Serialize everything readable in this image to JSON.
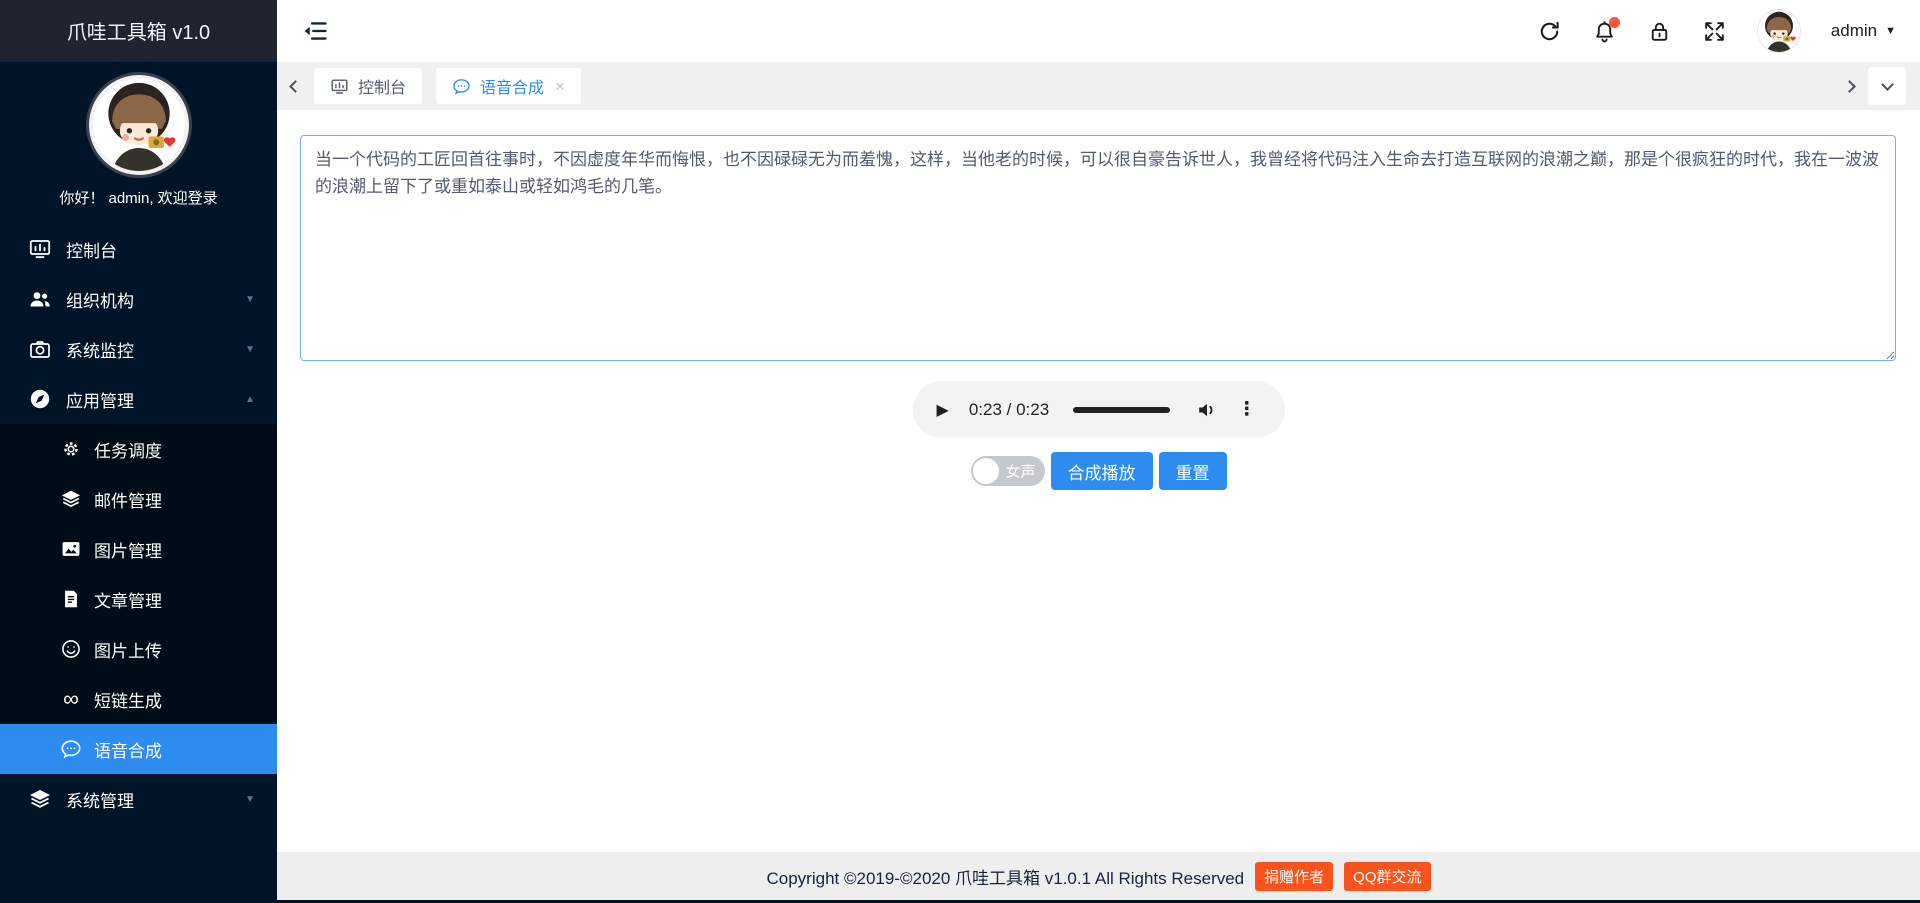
{
  "app": {
    "title": "爪哇工具箱 v1.0"
  },
  "sidebar": {
    "greeting": "你好！ admin, 欢迎登录",
    "menu": [
      {
        "label": "控制台",
        "icon": "dashboard-icon"
      },
      {
        "label": "组织机构",
        "icon": "users-icon",
        "caret": "down"
      },
      {
        "label": "系统监控",
        "icon": "camera-icon",
        "caret": "down"
      },
      {
        "label": "应用管理",
        "icon": "compass-icon",
        "caret": "up",
        "expanded": true
      },
      {
        "label": "系统管理",
        "icon": "layers-icon",
        "caret": "down"
      }
    ],
    "submenu": [
      {
        "label": "任务调度",
        "icon": "gear-icon"
      },
      {
        "label": "邮件管理",
        "icon": "layers-icon"
      },
      {
        "label": "图片管理",
        "icon": "image-icon"
      },
      {
        "label": "文章管理",
        "icon": "document-icon"
      },
      {
        "label": "图片上传",
        "icon": "smiley-icon"
      },
      {
        "label": "短链生成",
        "icon": "infinity-icon"
      },
      {
        "label": "语音合成",
        "icon": "speech-icon",
        "active": true
      }
    ]
  },
  "topbar": {
    "username": "admin"
  },
  "tabs": [
    {
      "label": "控制台",
      "icon": "dashboard-icon"
    },
    {
      "label": "语音合成",
      "icon": "speech-icon",
      "active": true,
      "closable": true,
      "close_glyph": "×"
    }
  ],
  "main": {
    "textarea_value": "当一个代码的工匠回首往事时，不因虚度年华而悔恨，也不因碌碌无为而羞愧，这样，当他老的时候，可以很自豪告诉世人，我曾经将代码注入生命去打造互联网的浪潮之巅，那是个很疯狂的时代，我在一波波的浪潮上留下了或重如泰山或轻如鸿毛的几笔。",
    "audio_player": {
      "time": "0:23 / 0:23",
      "menu_glyph": "⋮",
      "play_glyph": "▶"
    },
    "voice_toggle_label": "女声",
    "synthesize_button": "合成播放",
    "reset_button": "重置"
  },
  "footer": {
    "copyright": "Copyright ©2019-©2020 爪哇工具箱 v1.0.1 All Rights Reserved",
    "donate_button": "捐赠作者",
    "qq_button": "QQ群交流"
  },
  "glyphs": {
    "caret_down": "▼",
    "caret_up": "▲",
    "infinity": "∞"
  },
  "colors": {
    "accent": "#2d8cf0",
    "sidebar_bg": "#001427",
    "submenu_bg": "#000c17",
    "logo_bar_bg": "#20242e",
    "tabbar_bg": "#f0f0f1",
    "footer_bg": "#eeeeee",
    "footer_button": "#fa541c",
    "notification_badge": "#fb5638",
    "audio_player_bg": "#f1f3f4"
  }
}
